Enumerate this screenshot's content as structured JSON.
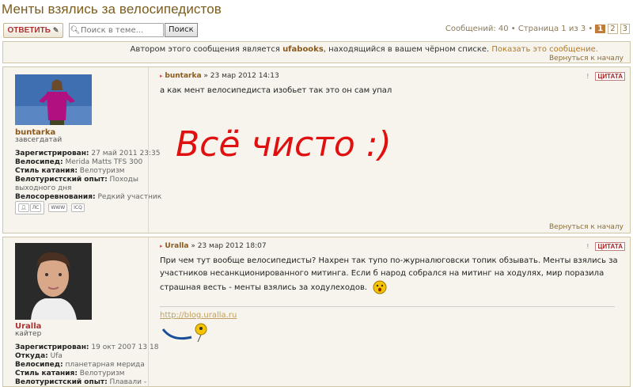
{
  "topic_title": "Менты взялись за велосипедистов",
  "toolbar": {
    "reply_label": "ОТВЕТИТЬ",
    "search_placeholder": "Поиск в теме...",
    "search_button": "Поиск",
    "pager_text": "Сообщений: 40 • Страница 1 из 3 •",
    "pages": [
      "1",
      "2",
      "3"
    ],
    "current_page": "1"
  },
  "ignored_notice": {
    "prefix": "Автором этого сообщения является",
    "author": "ufabooks",
    "middle": ", находящийся в вашем чёрном списке.",
    "link": "Показать это сообщение.",
    "top_link": "Вернуться к началу"
  },
  "posts": [
    {
      "username": "buntarka",
      "rank": "завсегдатай",
      "fields": [
        {
          "k": "Зарегистрирован:",
          "v": "27 май 2011 23:35"
        },
        {
          "k": "Велосипед:",
          "v": "Merida Matts TFS 300"
        },
        {
          "k": "Стиль катания:",
          "v": "Велотуризм"
        },
        {
          "k": "Велотуристский опыт:",
          "v": "Походы выходного дня"
        },
        {
          "k": "Велосоревнования:",
          "v": "Редкий участник"
        }
      ],
      "contacts": {
        "pm": "ЛС",
        "c1": "WWW",
        "c2": "ICQ"
      },
      "author": "buntarka",
      "date": "» 23 мар 2012 14:13",
      "quote": "ЦИТАТА",
      "text": "а как мент велосипедиста изобьет так это он сам упал",
      "handwriting": "Всё чисто :)",
      "top_link": "Вернуться к началу"
    },
    {
      "username": "Uralla",
      "rank": "кайтер",
      "fields": [
        {
          "k": "Зарегистрирован:",
          "v": "19 окт 2007 13:18"
        },
        {
          "k": "Откуда:",
          "v": "Ufa"
        },
        {
          "k": "Велосипед:",
          "v": "планетарная мерида"
        },
        {
          "k": "Стиль катания:",
          "v": "Велотуризм"
        },
        {
          "k": "Велотуристский опыт:",
          "v": "Плавали -"
        }
      ],
      "author": "Uralla",
      "date": "» 23 мар 2012 18:07",
      "quote": "ЦИТАТА",
      "text": "При чем тут вообще велосипедисты? Нахрен так тупо по-журналюговски топик обзывать. Менты взялись за участников несанкционированного митинга. Если б народ собрался на митинг на ходулях, мир поразила страшная весть - менты взялись за ходулеходов.",
      "signature_link": "http://blog.uralla.ru"
    }
  ],
  "colors": {
    "accent": "#8a5a1e",
    "link": "#b07a2a",
    "panel": "#f6f4ec",
    "border": "#cfc6a8",
    "handwriting": "#e01010"
  }
}
